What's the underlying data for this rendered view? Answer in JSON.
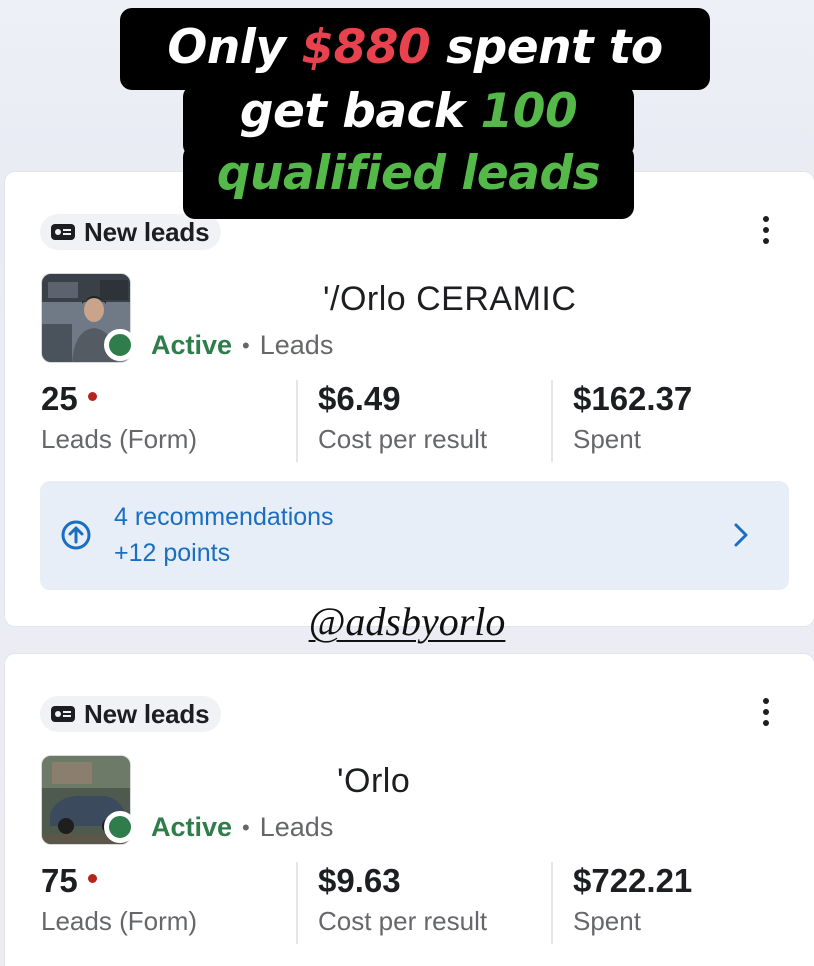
{
  "headline": {
    "line1_pre": "Only",
    "line1_amount": "$880",
    "line1_post": "spent to",
    "line2_pre": "get back",
    "line2_count": "100",
    "line3": "qualified leads",
    "amount_color": "#e8424f",
    "highlight_color": "#55b94a"
  },
  "watermark": "@adsbyorlo",
  "campaigns": [
    {
      "chip_label": "New leads",
      "chip_icon": "id-card-icon",
      "name": "'/Orlo CERAMIC",
      "status": "Active",
      "separator": "•",
      "objective": "Leads",
      "metrics": [
        {
          "value": "25",
          "label": "Leads (Form)",
          "has_dot": true
        },
        {
          "value": "$6.49",
          "label": "Cost per result"
        },
        {
          "value": "$162.37",
          "label": "Spent"
        }
      ],
      "recommendation": {
        "title": "4 recommendations",
        "points": "+12 points"
      }
    },
    {
      "chip_label": "New leads",
      "chip_icon": "id-card-icon",
      "name": "'Orlo",
      "status": "Active",
      "separator": "•",
      "objective": "Leads",
      "metrics": [
        {
          "value": "75",
          "label": "Leads (Form)",
          "has_dot": true
        },
        {
          "value": "$9.63",
          "label": "Cost per result"
        },
        {
          "value": "$722.21",
          "label": "Spent"
        }
      ]
    }
  ],
  "colors": {
    "active_green": "#2e7d4a",
    "link_blue": "#1a6ec2",
    "reco_bg": "#e7eef8",
    "alert_red": "#b3261e"
  }
}
